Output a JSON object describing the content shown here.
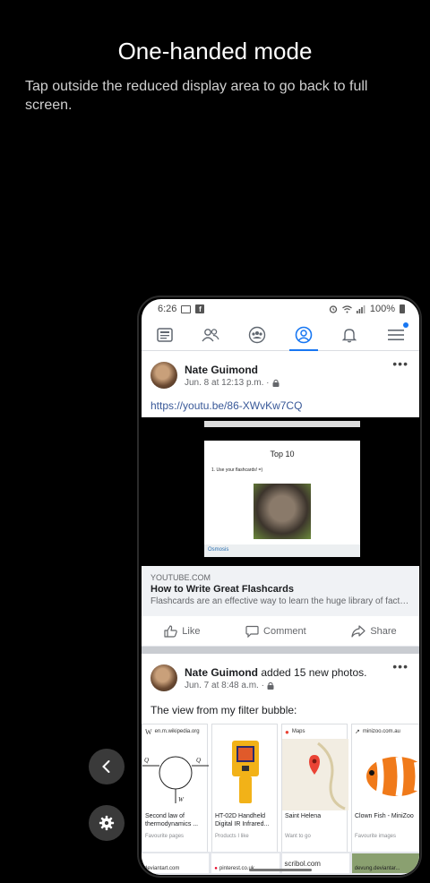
{
  "overlay": {
    "title": "One-handed mode",
    "subtitle": "Tap outside the reduced display area to go back to full screen."
  },
  "side_controls": {
    "back_icon": "chevron-left-icon",
    "settings_icon": "gear-icon"
  },
  "status_bar": {
    "time": "6:26",
    "battery": "100%"
  },
  "nav_tabs": [
    {
      "name": "news-feed",
      "icon": "feed-icon"
    },
    {
      "name": "friends",
      "icon": "friends-icon"
    },
    {
      "name": "groups",
      "icon": "groups-icon"
    },
    {
      "name": "profile",
      "icon": "profile-icon",
      "active": true
    },
    {
      "name": "notifications",
      "icon": "bell-icon"
    },
    {
      "name": "menu",
      "icon": "menu-icon",
      "badge": true
    }
  ],
  "post1": {
    "author": "Nate Guimond",
    "time": "Jun. 8 at 12:13 p.m. ·",
    "link": "https://youtu.be/86-XWvKw7CQ",
    "video_slide": {
      "title": "Top 10",
      "item": "1.   Use your flashcards! =)",
      "brand": "Osmosis"
    },
    "link_card": {
      "domain": "YOUTUBE.COM",
      "title": "How to Write Great Flashcards",
      "description": "Flashcards are an effective way to learn the huge library of facts i..."
    },
    "actions": {
      "like": "Like",
      "comment": "Comment",
      "share": "Share"
    }
  },
  "post2": {
    "author": "Nate Guimond",
    "action": " added 15 new photos.",
    "time": "Jun. 7 at 8:48 a.m. ·",
    "caption": "The view from my filter bubble:",
    "cards": [
      {
        "domain": "en.m.wikipedia.org",
        "title": "Second law of thermodynamics ...",
        "sub": "Favourite pages"
      },
      {
        "domain": "",
        "title": "HT-02D Handheld Digital IR Infrared...",
        "sub": "Products I like"
      },
      {
        "domain": "Maps",
        "title": "Saint Helena",
        "sub": "Want to go"
      },
      {
        "domain": "minizoo.com.au",
        "title": "Clown Fish - MiniZoo",
        "sub": "Favourite images"
      }
    ],
    "strip": [
      {
        "text": "deviantart.com"
      },
      {
        "text": "pinterest.co.uk"
      },
      {
        "text": "scribol.com"
      },
      {
        "text": "devung.deviantar..."
      }
    ]
  },
  "colors": {
    "accent": "#1877f2",
    "link": "#385898"
  }
}
